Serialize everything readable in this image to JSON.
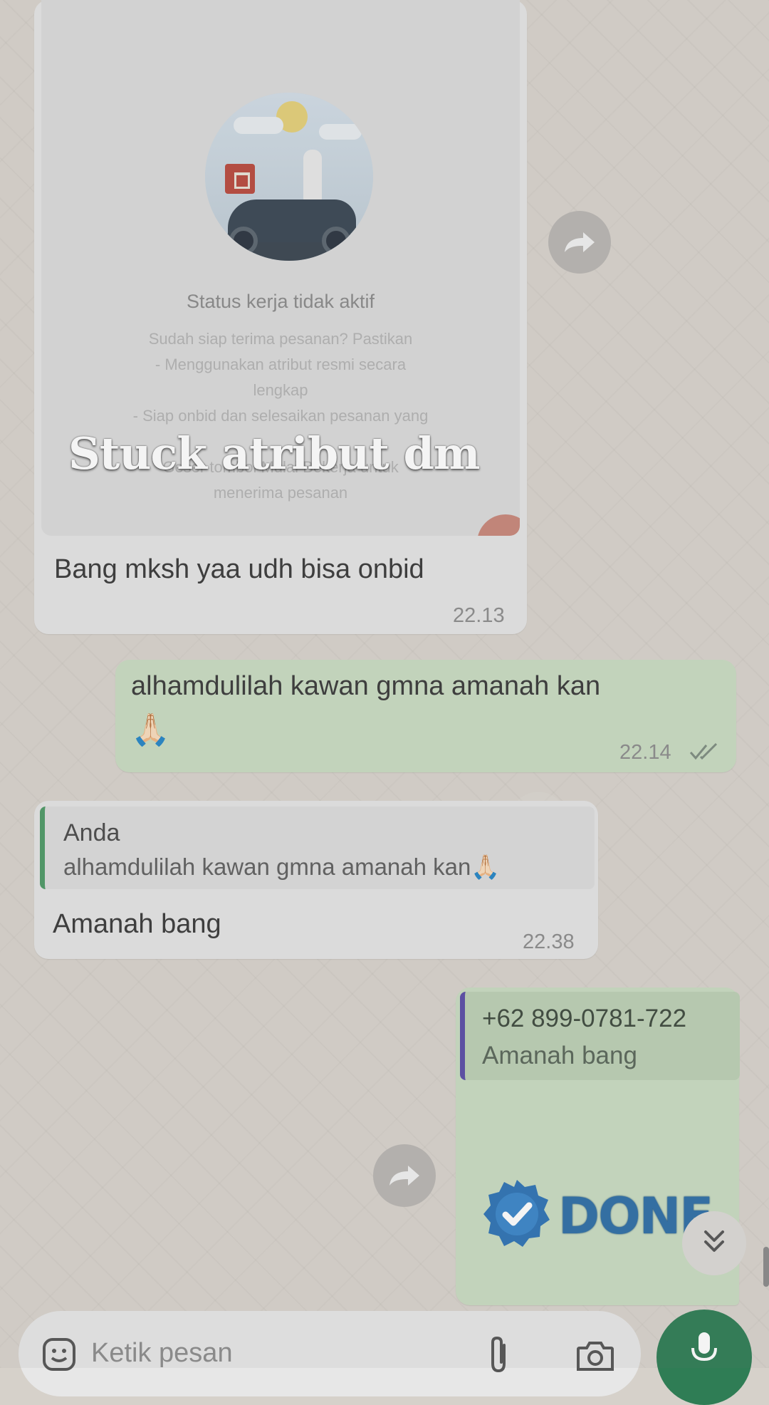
{
  "overlay_caption": "Stuck atribut dm",
  "messages": {
    "image_message": {
      "status_title": "Status kerja tidak aktif",
      "status_lines": [
        "Sudah siap terima pesanan? Pastikan",
        "- Menggunakan atribut resmi secara",
        "lengkap",
        "- Siap onbid dan selesaikan pesanan yang",
        "",
        "Geser tombol Mulai Bekerja untuk",
        "menerima pesanan"
      ],
      "text": "Bang mksh yaa udh bisa onbid",
      "time": "22.13"
    },
    "outgoing_1": {
      "text": "alhamdulilah kawan gmna amanah kan",
      "emoji": "🙏🏻",
      "time": "22.14",
      "status_icon": "double-check-icon"
    },
    "incoming_reply": {
      "quote_author": "Anda",
      "quote_text": "alhamdulilah kawan gmna amanah kan🙏🏻",
      "text": "Amanah bang",
      "time": "22.38"
    },
    "outgoing_reply": {
      "quote_author": "+62 899-0781-722",
      "quote_text": "Amanah bang",
      "sticker_text": "DONE"
    }
  },
  "input": {
    "placeholder": "Ketik pesan"
  },
  "colors": {
    "outgoing_bubble": "#c9dcc2",
    "incoming_bubble": "#e4e4e4",
    "mic_button": "#2f7d55",
    "quote_bar_green": "#4f9a66",
    "quote_bar_purple": "#5b4ea7",
    "done_badge": "#2f6fa6"
  },
  "icons": [
    "forward-icon",
    "double-check-icon",
    "scroll-down-icon",
    "sticker-icon",
    "attach-icon",
    "camera-icon",
    "mic-icon",
    "check-badge-icon"
  ]
}
